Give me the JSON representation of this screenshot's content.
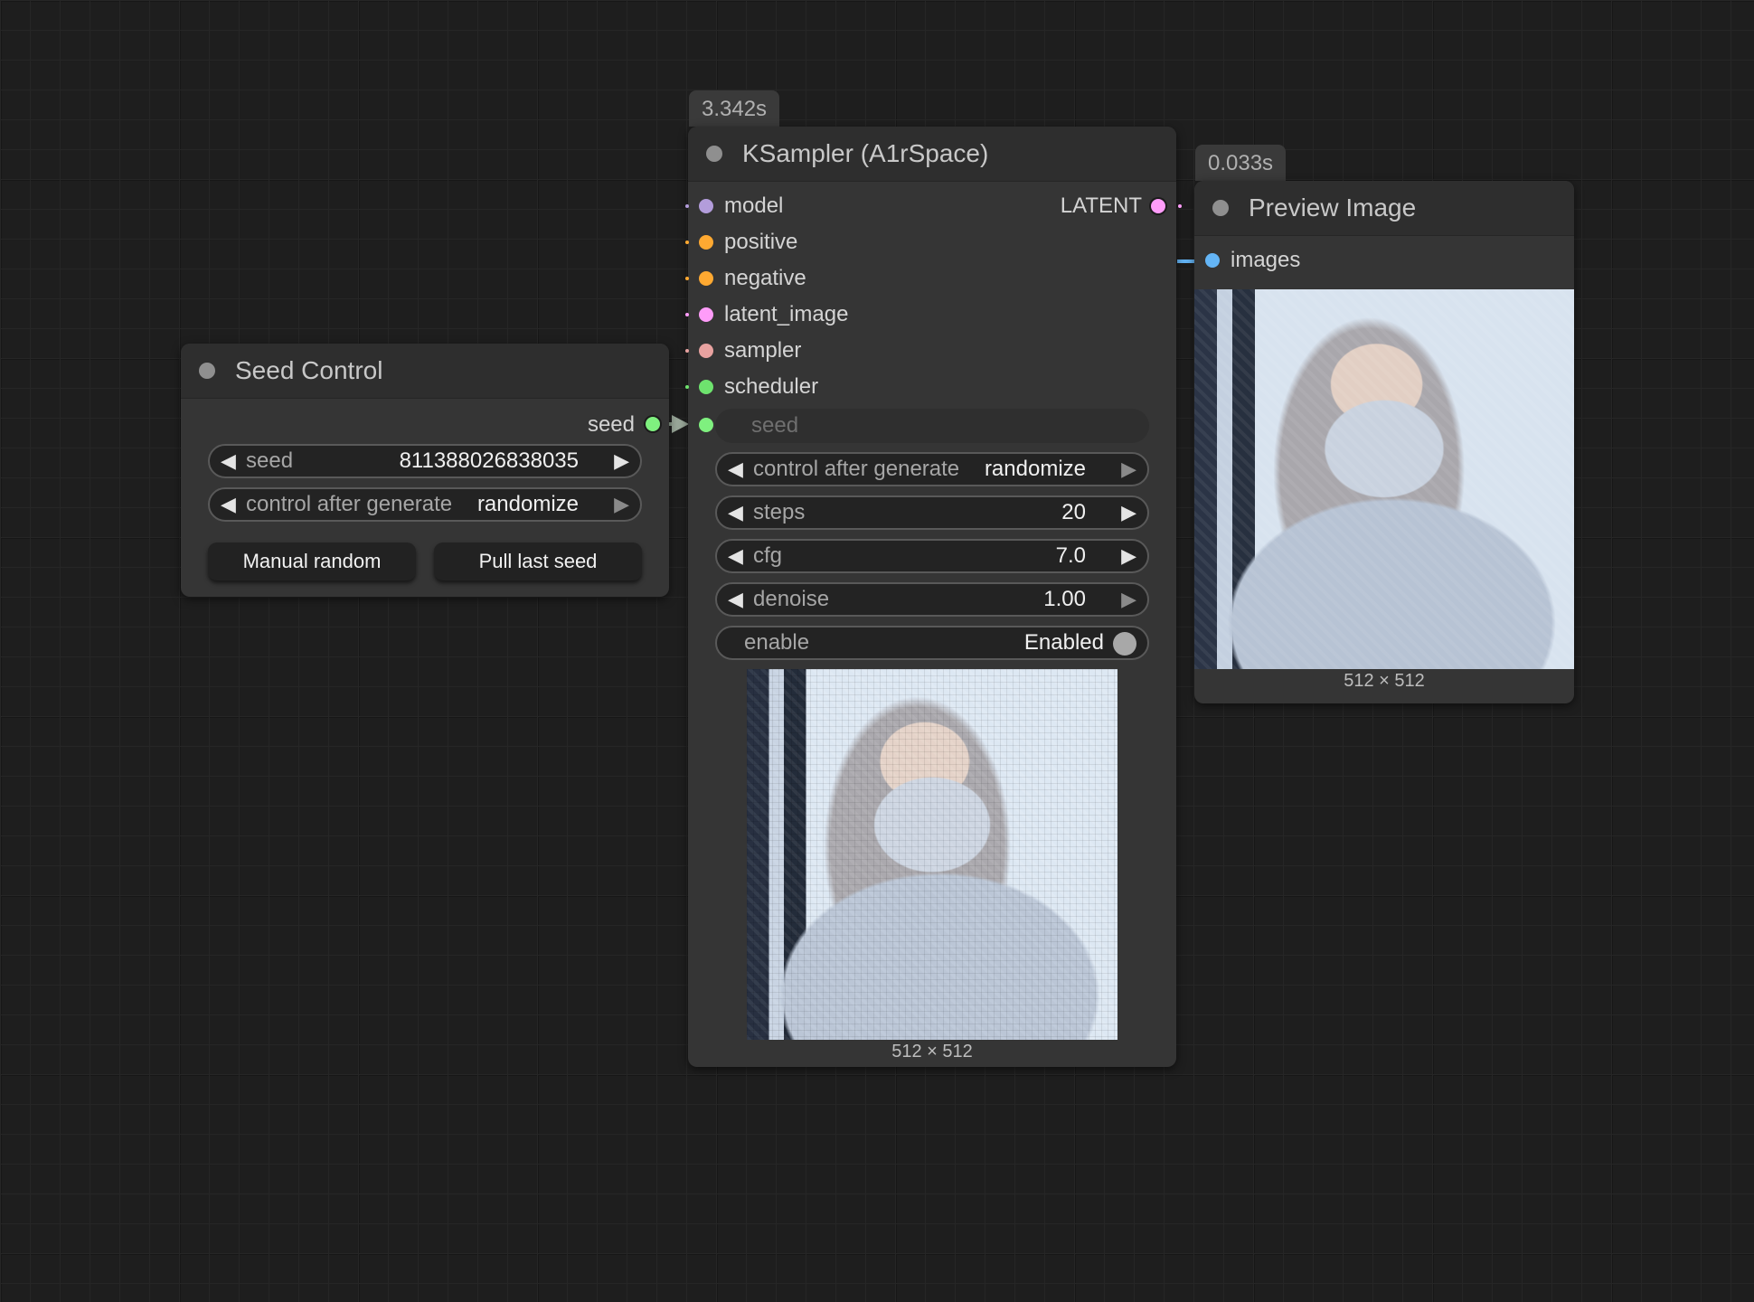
{
  "seed_control": {
    "title": "Seed Control",
    "output_label": "seed",
    "seed_widget": {
      "name": "seed",
      "value": "811388026838035"
    },
    "control_widget": {
      "name": "control after generate",
      "value": "randomize"
    },
    "manual_random_label": "Manual random",
    "pull_last_seed_label": "Pull last seed"
  },
  "ksampler": {
    "timing": "3.342s",
    "title": "KSampler (A1rSpace)",
    "inputs": [
      "model",
      "positive",
      "negative",
      "latent_image",
      "sampler",
      "scheduler"
    ],
    "output_label": "LATENT",
    "seed_input_label": "seed",
    "widgets": {
      "control": {
        "name": "control after generate",
        "value": "randomize"
      },
      "steps": {
        "name": "steps",
        "value": "20"
      },
      "cfg": {
        "name": "cfg",
        "value": "7.0"
      },
      "denoise": {
        "name": "denoise",
        "value": "1.00"
      },
      "enable": {
        "name": "enable",
        "value": "Enabled"
      }
    },
    "preview_caption": "512 × 512"
  },
  "preview_image": {
    "timing": "0.033s",
    "title": "Preview Image",
    "input_label": "images",
    "caption": "512 × 512"
  },
  "colors": {
    "canvas_bg": "#1e1e1e",
    "node_bg": "#353535",
    "model": "#b39ddb",
    "positive": "#ffa931",
    "negative": "#ffa931",
    "latent": "#ff9cf9",
    "sampler": "#e8a2a0",
    "scheduler": "#6ee36e",
    "seed": "#7ff07f",
    "image": "#64b5f6"
  }
}
